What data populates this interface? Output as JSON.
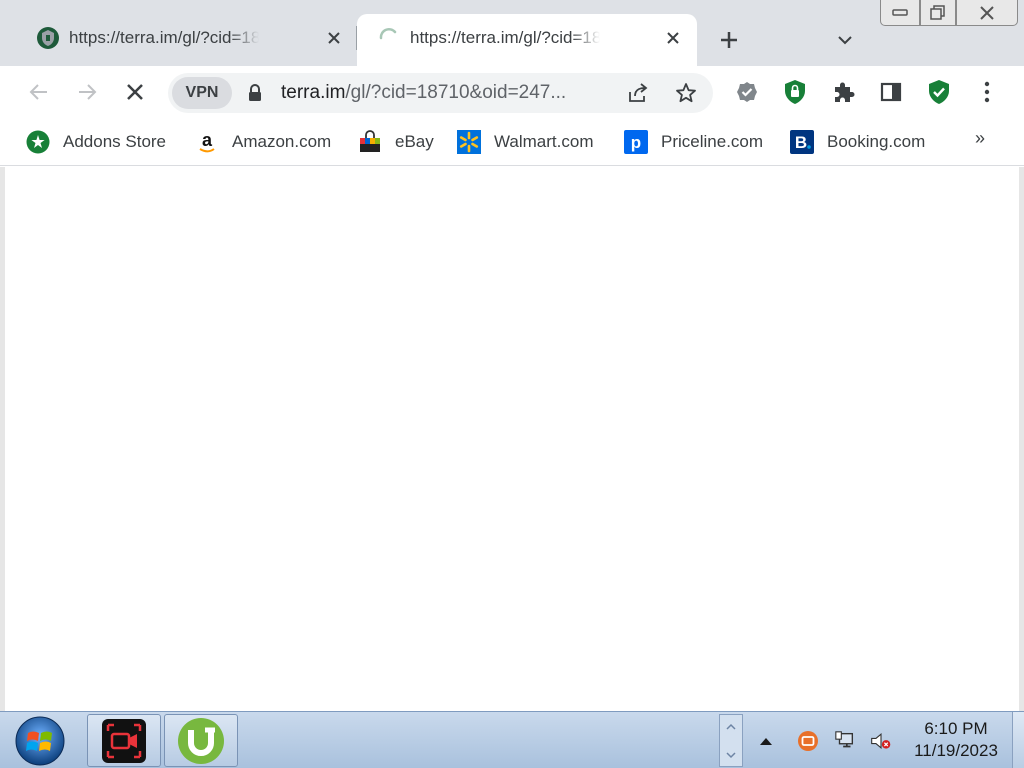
{
  "tabs": [
    {
      "title": "https://terra.im/gl/?cid=18710&oid=247",
      "state": "loaded",
      "favicon": "shield-favicon-icon"
    },
    {
      "title": "https://terra.im/gl/?cid=18710&oid=247",
      "state": "loading",
      "favicon": "spinner-icon"
    }
  ],
  "toolbar": {
    "vpn_label": "VPN",
    "url_host": "terra.im",
    "url_path": "/gl/?cid=18710&oid=247..."
  },
  "bookmarks": [
    {
      "label": "Addons Store",
      "icon": "addons-store-icon",
      "color": "#188038"
    },
    {
      "label": "Amazon.com",
      "icon": "amazon-icon",
      "color": "#000000"
    },
    {
      "label": "eBay",
      "icon": "ebay-icon",
      "color": "#e53238"
    },
    {
      "label": "Walmart.com",
      "icon": "walmart-icon",
      "color": "#0071dc"
    },
    {
      "label": "Priceline.com",
      "icon": "priceline-icon",
      "color": "#0068ef"
    },
    {
      "label": "Booking.com",
      "icon": "booking-icon",
      "color": "#003580"
    }
  ],
  "bookmarks_overflow": "»",
  "taskbar": {
    "apps": [
      {
        "name": "screen-recorder",
        "icon": "screen-recorder-icon"
      },
      {
        "name": "utorrent",
        "icon": "utorrent-icon"
      }
    ],
    "clock": {
      "time": "6:10 PM",
      "date": "11/19/2023"
    }
  },
  "colors": {
    "tabstrip": "#dee1e6",
    "accent_green": "#188038",
    "taskbar": "#b7cbe3"
  }
}
